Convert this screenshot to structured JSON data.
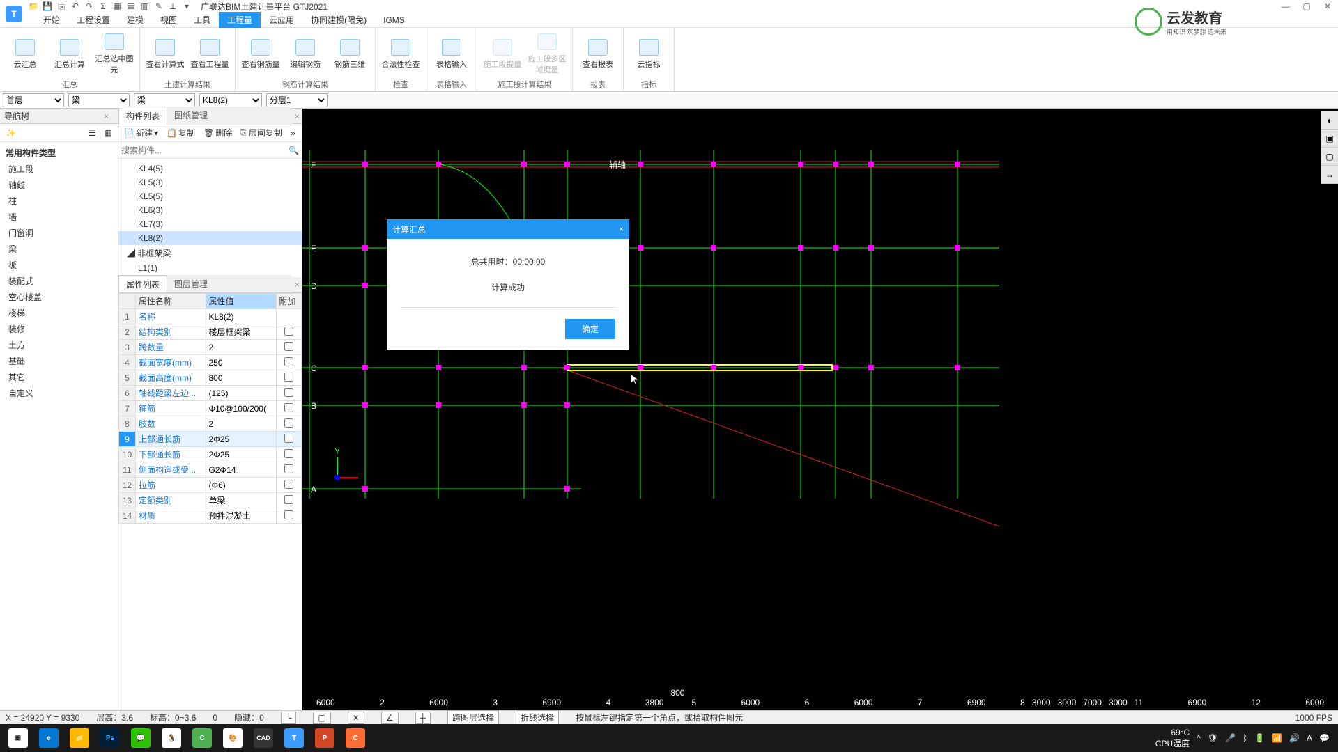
{
  "titlebar": {
    "title": "广联达BIM土建计量平台 GTJ2021"
  },
  "menu": {
    "items": [
      "开始",
      "工程设置",
      "建模",
      "视图",
      "工具",
      "工程量",
      "云应用",
      "协同建模(限免)",
      "IGMS"
    ],
    "active_index": 5
  },
  "ribbon": {
    "groups": [
      {
        "name": "汇总",
        "buttons": [
          {
            "label": "云汇总"
          },
          {
            "label": "汇总计算"
          },
          {
            "label": "汇总选中图元"
          }
        ]
      },
      {
        "name": "土建计算结果",
        "buttons": [
          {
            "label": "查看计算式"
          },
          {
            "label": "查看工程量"
          }
        ]
      },
      {
        "name": "钢筋计算结果",
        "buttons": [
          {
            "label": "查看钢筋量"
          },
          {
            "label": "编辑钢筋"
          },
          {
            "label": "钢筋三维"
          }
        ]
      },
      {
        "name": "检查",
        "buttons": [
          {
            "label": "合法性检查"
          }
        ]
      },
      {
        "name": "表格输入",
        "buttons": [
          {
            "label": "表格输入"
          }
        ]
      },
      {
        "name": "施工段计算结果",
        "buttons": [
          {
            "label": "施工段提量",
            "disabled": true
          },
          {
            "label": "施工段多区域提量",
            "disabled": true
          }
        ]
      },
      {
        "name": "报表",
        "buttons": [
          {
            "label": "查看报表"
          }
        ]
      },
      {
        "name": "指标",
        "buttons": [
          {
            "label": "云指标"
          }
        ]
      }
    ]
  },
  "dropdowns": {
    "floor": "首层",
    "cat1": "梁",
    "cat2": "梁",
    "component": "KL8(2)",
    "layer": "分层1"
  },
  "nav_tree": {
    "title": "导航树",
    "header": "常用构件类型",
    "items": [
      "施工段",
      "轴线",
      "柱",
      "墙",
      "门窗洞",
      "梁",
      "板",
      "装配式",
      "空心楼盖",
      "楼梯",
      "装修",
      "土方",
      "基础",
      "其它",
      "自定义"
    ]
  },
  "comp_panel": {
    "tabs": [
      "构件列表",
      "图纸管理"
    ],
    "active_tab": 0,
    "toolbar": [
      {
        "icon": "new",
        "label": "新建"
      },
      {
        "icon": "copy",
        "label": "复制"
      },
      {
        "icon": "delete",
        "label": "删除"
      },
      {
        "icon": "floor-copy",
        "label": "层间复制"
      }
    ],
    "search_placeholder": "搜索构件...",
    "parent": "非框架梁",
    "items": [
      "KL4(5)",
      "KL5(3)",
      "KL5(5)",
      "KL6(3)",
      "KL7(3)",
      "KL8(2)"
    ],
    "extra": "L1(1)",
    "selected_index": 5
  },
  "prop_panel": {
    "tabs": [
      "属性列表",
      "图层管理"
    ],
    "active_tab": 0,
    "headers": {
      "name": "属性名称",
      "value": "属性值",
      "attach": "附加"
    },
    "rows": [
      {
        "n": 1,
        "name": "名称",
        "value": "KL8(2)",
        "attach": null
      },
      {
        "n": 2,
        "name": "结构类别",
        "value": "楼层框架梁",
        "attach": false
      },
      {
        "n": 3,
        "name": "跨数量",
        "value": "2",
        "attach": false
      },
      {
        "n": 4,
        "name": "截面宽度(mm)",
        "value": "250",
        "attach": false
      },
      {
        "n": 5,
        "name": "截面高度(mm)",
        "value": "800",
        "attach": false
      },
      {
        "n": 6,
        "name": "轴线距梁左边...",
        "value": "(125)",
        "attach": false
      },
      {
        "n": 7,
        "name": "箍筋",
        "value": "Φ10@100/200(",
        "attach": false
      },
      {
        "n": 8,
        "name": "肢数",
        "value": "2",
        "attach": false
      },
      {
        "n": 9,
        "name": "上部通长筋",
        "value": "2Φ25",
        "attach": false,
        "selected": true
      },
      {
        "n": 10,
        "name": "下部通长筋",
        "value": "2Φ25",
        "attach": false
      },
      {
        "n": 11,
        "name": "侧面构造或受...",
        "value": "G2Φ14",
        "attach": false
      },
      {
        "n": 12,
        "name": "拉筋",
        "value": "(Φ6)",
        "attach": false
      },
      {
        "n": 13,
        "name": "定额类别",
        "value": "单梁",
        "attach": false
      },
      {
        "n": 14,
        "name": "材质",
        "value": "预拌混凝土",
        "attach": false
      }
    ]
  },
  "dialog": {
    "title": "计算汇总",
    "time_label": "总共用时：",
    "time_value": "00:00:00",
    "message": "计算成功",
    "ok": "确定"
  },
  "statusbar": {
    "coords": "X = 24920 Y = 9330",
    "floor_height_label": "层高：",
    "floor_height": "3.6",
    "elev_label": "标高：",
    "elev": "0~3.6",
    "zero1": "0",
    "hidden_label": "隐藏：",
    "hidden": "0",
    "cross_layer": "跨图层选择",
    "polyline": "折线选择",
    "hint": "按鼠标左键指定第一个角点，或拾取构件图元",
    "fps": "1000 FPS"
  },
  "canvas": {
    "axis_label": "辅轴",
    "grid_x_labels": [
      "6000",
      "2",
      "6000",
      "3",
      "6900",
      "4",
      "3800",
      "800",
      "5",
      "6000",
      "6",
      "6000",
      "7",
      "6900",
      "8",
      "3000",
      "3000",
      "7000",
      "3000",
      "11",
      "6900",
      "12",
      "6000"
    ],
    "grid_y_labels": [
      "F",
      "E",
      "D",
      "C",
      "B",
      "A"
    ]
  },
  "tray": {
    "temp": "69°C",
    "cpu": "CPU温度"
  },
  "logo": {
    "title": "云发教育",
    "subtitle": "用知识 筑梦想 造未来"
  }
}
